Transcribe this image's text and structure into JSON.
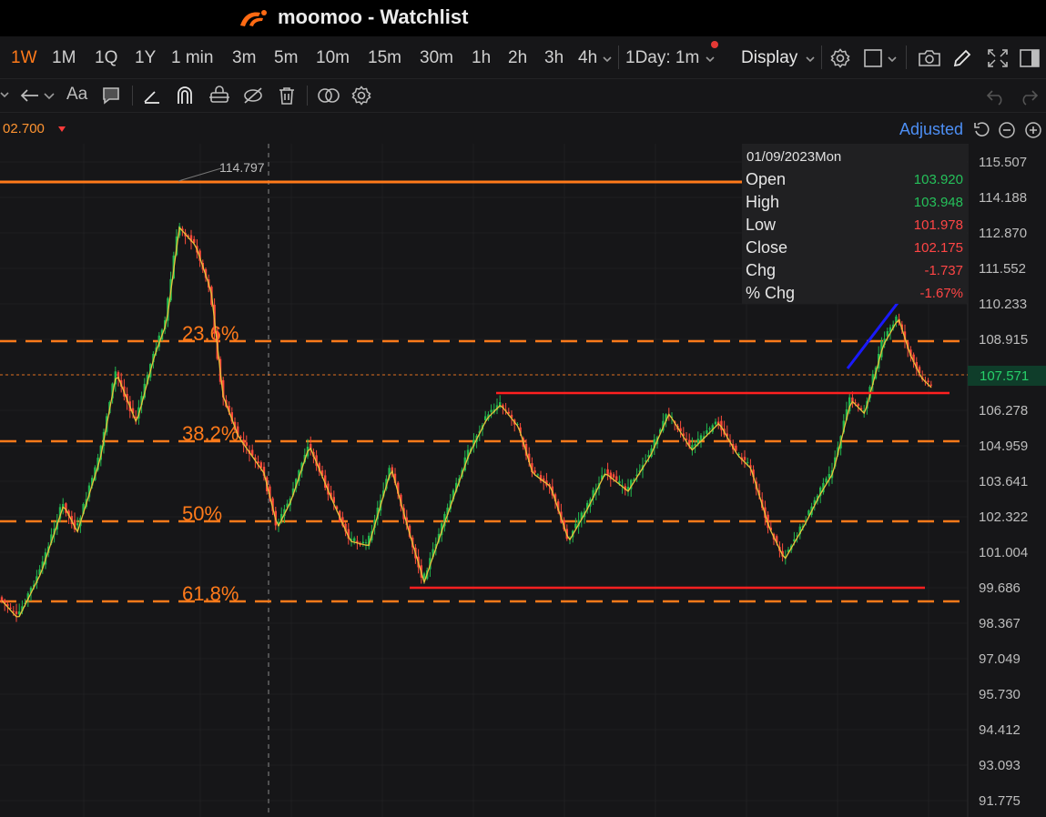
{
  "app": {
    "name": "moomoo - Watchlist"
  },
  "timeframes": [
    {
      "label": "1W",
      "active": true
    },
    {
      "label": "1M"
    },
    {
      "label": "1Q"
    },
    {
      "label": "1Y"
    },
    {
      "label": "1 min"
    },
    {
      "label": "3m"
    },
    {
      "label": "5m"
    },
    {
      "label": "10m"
    },
    {
      "label": "15m"
    },
    {
      "label": "30m"
    },
    {
      "label": "1h"
    },
    {
      "label": "2h"
    },
    {
      "label": "3h"
    },
    {
      "label": "4h"
    }
  ],
  "toolbar": {
    "interval_label": "1Day: 1m",
    "display_label": "Display"
  },
  "drawing_tools": [
    "arrow-left-icon",
    "text-icon",
    "comment-icon",
    "line-icon",
    "magnet-icon",
    "lock-icon",
    "hide-icon",
    "trash-icon",
    "link-icon",
    "gear-icon",
    "undo-icon",
    "redo-icon"
  ],
  "header": {
    "current_price": "02.700",
    "adjusted_label": "Adjusted"
  },
  "price_axis": [
    "115.507",
    "114.188",
    "112.870",
    "111.552",
    "110.233",
    "108.915",
    "107.571",
    "106.278",
    "104.959",
    "103.641",
    "102.322",
    "101.004",
    "99.686",
    "98.367",
    "97.049",
    "95.730",
    "94.412",
    "93.093",
    "91.775"
  ],
  "chart": {
    "high_label": "114.797",
    "last_price": "107.571",
    "fib_labels": [
      "23.6%",
      "38.2%",
      "50%",
      "61.8%"
    ]
  },
  "infobox": {
    "date": "01/09/2023Mon",
    "rows": [
      {
        "label": "Open",
        "value": "103.920",
        "dir": "up"
      },
      {
        "label": "High",
        "value": "103.948",
        "dir": "up"
      },
      {
        "label": "Low",
        "value": "101.978",
        "dir": "down"
      },
      {
        "label": "Close",
        "value": "102.175",
        "dir": "down"
      },
      {
        "label": "Chg",
        "value": "-1.737",
        "dir": "down"
      },
      {
        "label": "% Chg",
        "value": "-1.67%",
        "dir": "down"
      }
    ]
  },
  "colors": {
    "accent": "#ff7a1a",
    "up": "#25c05a",
    "down": "#ff4545",
    "fib": "#ff7a1a",
    "support": "#ff2020",
    "trend": "#1a1aff",
    "link": "#4d8ff5"
  }
}
